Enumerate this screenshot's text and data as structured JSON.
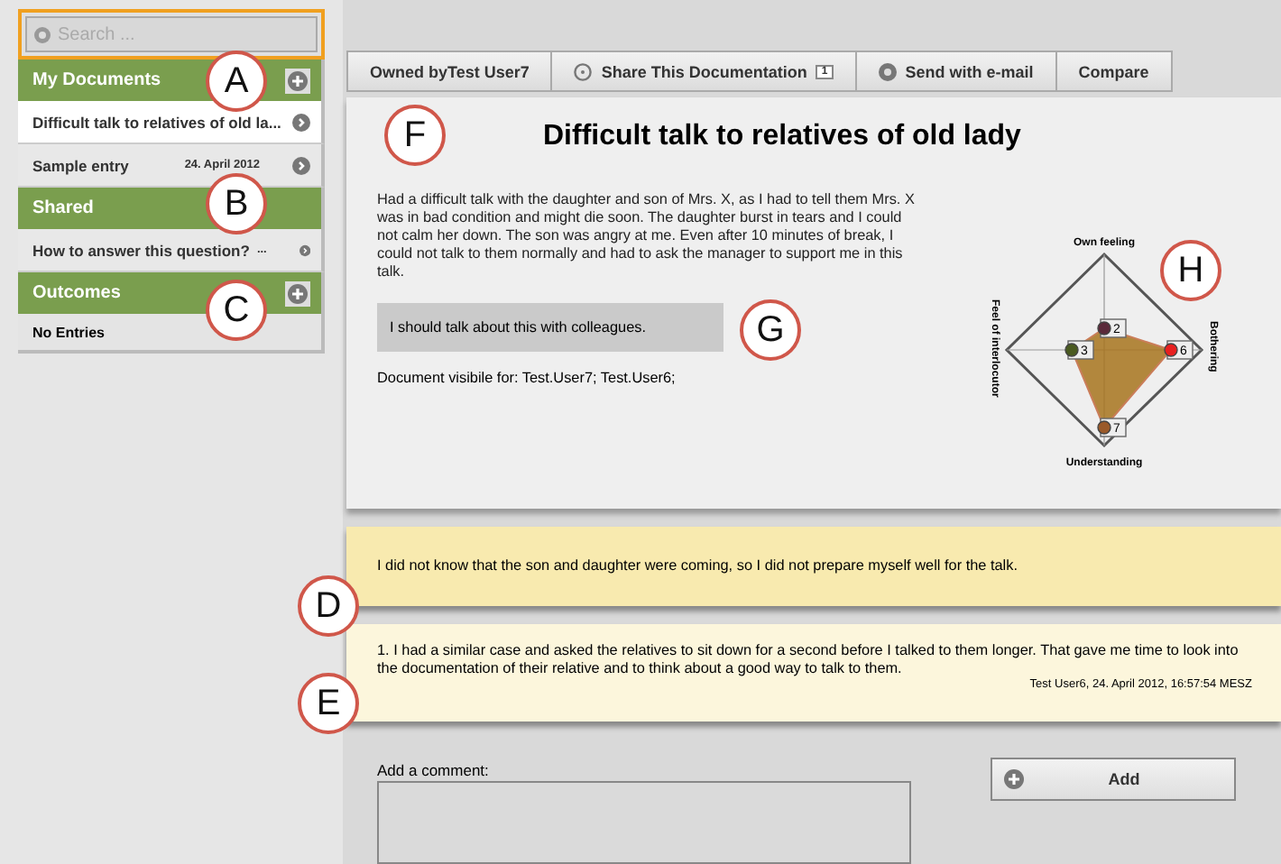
{
  "search": {
    "placeholder": "Search ..."
  },
  "sidebar": [
    {
      "kind": "header",
      "label": "My Documents",
      "add": true
    },
    {
      "kind": "item",
      "label": "Difficult talk to relatives of old la...",
      "selected": true
    },
    {
      "kind": "item",
      "label": "Sample entry",
      "date": "24. April 2012",
      "selected": false
    },
    {
      "kind": "header",
      "label": "Shared",
      "add": false
    },
    {
      "kind": "item",
      "label": "How to answer this question?",
      "date": "...",
      "selected": false
    },
    {
      "kind": "header",
      "label": "Outcomes",
      "add": true
    },
    {
      "kind": "empty",
      "label": "No Entries"
    }
  ],
  "toolbar": [
    {
      "kind": "plain",
      "label": "Owned byTest User7"
    },
    {
      "kind": "share",
      "label": "Share This Documentation",
      "count": "1"
    },
    {
      "kind": "mail",
      "label": "Send with e-mail"
    },
    {
      "kind": "plain",
      "label": "Compare"
    }
  ],
  "document": {
    "title": "Difficult talk to relatives of old lady",
    "body": "Had a difficult talk with the daughter and son of Mrs. X, as I had to tell them Mrs. X was in bad condition and might die soon. The daughter burst in tears and I could not calm her down. The son was angry at me. Even after 10 minutes of break, I could not talk to them normally and had to ask the manager to support me in this talk.",
    "note": "I should talk about this with colleagues.",
    "visibility": "Document visibile for: Test.User7; Test.User6;",
    "radar": {
      "axes": [
        "Own feeling",
        "Bothering",
        "Understanding",
        "Feel of interlocutor"
      ],
      "points": [
        {
          "label": "2",
          "color": "#5a2a3a"
        },
        {
          "label": "6",
          "color": "#e82020"
        },
        {
          "label": "7",
          "color": "#9a5a2a"
        },
        {
          "label": "3",
          "color": "#4a5a20"
        }
      ]
    }
  },
  "comments": [
    {
      "kind": "outcome",
      "text": "I did not know that the son and daughter were coming, so I did not prepare myself well for the talk."
    },
    {
      "kind": "reply",
      "text": "1. I had a similar case and asked the relatives to sit down for a second before I talked to them longer. That gave me time to look into the documentation of their relative and to think about a good way to talk to them.",
      "meta": "Test User6, 24. April 2012, 16:57:54 MESZ"
    }
  ],
  "comment_form": {
    "label": "Add a comment:",
    "button": "Add"
  },
  "callouts": [
    "A",
    "B",
    "C",
    "D",
    "E",
    "F",
    "G",
    "H"
  ]
}
